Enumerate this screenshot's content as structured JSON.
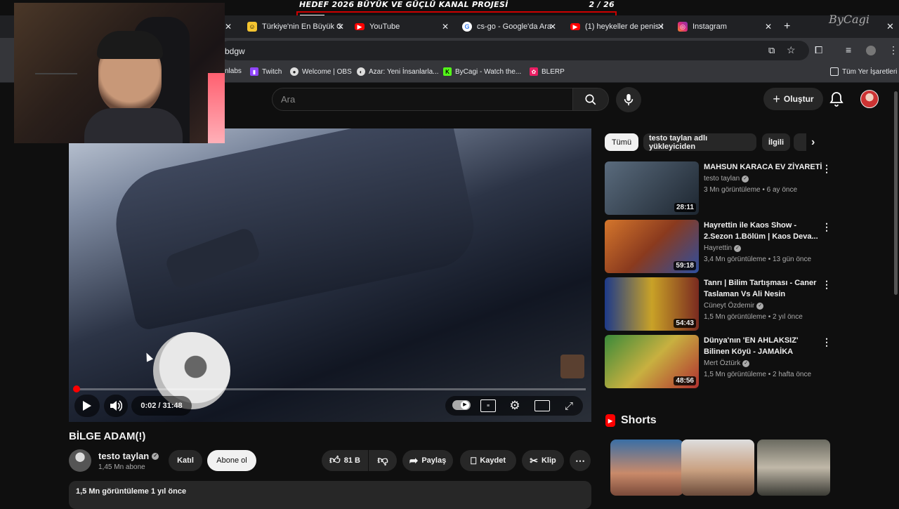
{
  "overlay": {
    "goal_title": "HEDEF 2026 BÜYÜK VE GÜÇLÜ KANAL PROJESİ",
    "goal_count": "2  / 26",
    "goal_progress": 0.077,
    "watermark": "ByCagi"
  },
  "browser": {
    "tabs": [
      {
        "label": "Türkiye'nin En Büyük C",
        "icon": "emoji-favicon"
      },
      {
        "label": "YouTube",
        "icon": "youtube-icon"
      },
      {
        "label": "cs-go - Google'da Ara",
        "icon": "google-icon"
      },
      {
        "label": "(1) heykeller de penis !",
        "icon": "youtube-icon"
      },
      {
        "label": "Instagram",
        "icon": "instagram-icon"
      }
    ],
    "url_fragment": "bdgw",
    "bookmarks": [
      {
        "label": "nlabs"
      },
      {
        "label": "Twitch",
        "icon": "twitch-icon"
      },
      {
        "label": "Welcome | OBS",
        "icon": "obs-icon"
      },
      {
        "label": "Azar: Yeni İnsanlarla...",
        "icon": "azar-icon"
      },
      {
        "label": "ByCagi - Watch the...",
        "icon": "kick-icon"
      },
      {
        "label": "BLERP",
        "icon": "blerp-icon"
      }
    ],
    "all_bookmarks": "Tüm Yer İşaretleri"
  },
  "youtube": {
    "search_placeholder": "Ara",
    "create_label": "Oluştur",
    "player": {
      "time": "0:02 / 31:48",
      "progress": 0.001
    },
    "video": {
      "title": "BİLGE ADAM(!)",
      "channel": "testo taylan",
      "subscribers": "1,45 Mn abone",
      "join_label": "Katıl",
      "subscribe_label": "Abone ol",
      "likes": "81 B",
      "share_label": "Paylaş",
      "save_label": "Kaydet",
      "clip_label": "Klip",
      "desc_line": "1,5 Mn görüntüleme  1 yıl önce"
    },
    "chips": [
      "Tümü",
      "testo taylan adlı yükleyiciden",
      "İlgili"
    ],
    "related": [
      {
        "title": "MAHSUN KARACA EV ZİYARETİ",
        "channel": "testo taylan",
        "meta": "3 Mn görüntüleme • 6 ay önce",
        "duration": "28:11"
      },
      {
        "title": "Hayrettin ile Kaos Show - 2.Sezon 1.Bölüm | Kaos Deva...",
        "channel": "Hayrettin",
        "meta": "3,4 Mn görüntüleme • 13 gün önce",
        "duration": "59:18"
      },
      {
        "title": "Tanrı | Bilim Tartışması - Caner Taslaman Vs Ali Nesin",
        "channel": "Cüneyt Özdemir",
        "meta": "1,5 Mn görüntüleme • 2 yıl önce",
        "duration": "54:43"
      },
      {
        "title": "Dünya'nın 'EN AHLAKSIZ' Bilinen Köyü - JAMAİKA",
        "channel": "Mert Öztürk",
        "meta": "1,5 Mn görüntüleme • 2 hafta önce",
        "duration": "48:56"
      }
    ],
    "shorts_label": "Shorts"
  },
  "colors": {
    "accent": "#ff0000",
    "bg": "#0f0f0f",
    "surface": "#272727"
  }
}
